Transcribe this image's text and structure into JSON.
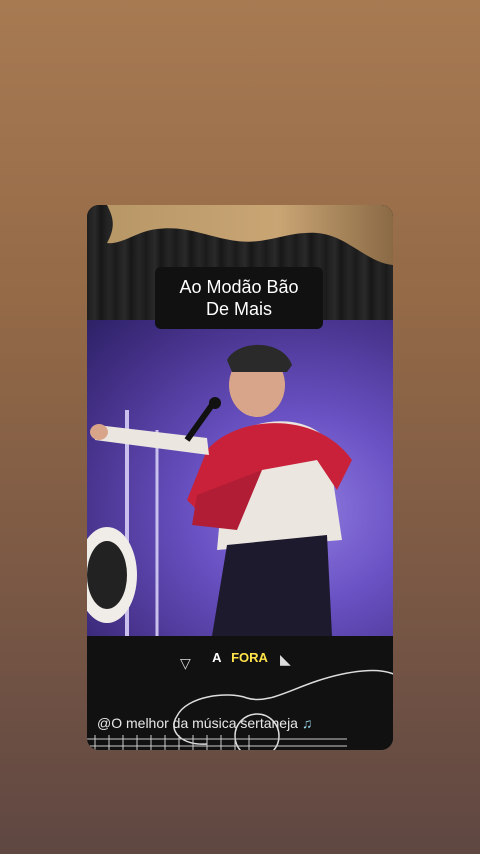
{
  "video": {
    "title_line1": "Ao Modão Bão",
    "title_line2": "De Mais",
    "lyric_word1": "A",
    "lyric_word2": "FORA",
    "caption": "@O melhor da música sertaneja",
    "caption_icon": "music-notes-icon",
    "lyric_highlight_color": "#ffe34a"
  }
}
